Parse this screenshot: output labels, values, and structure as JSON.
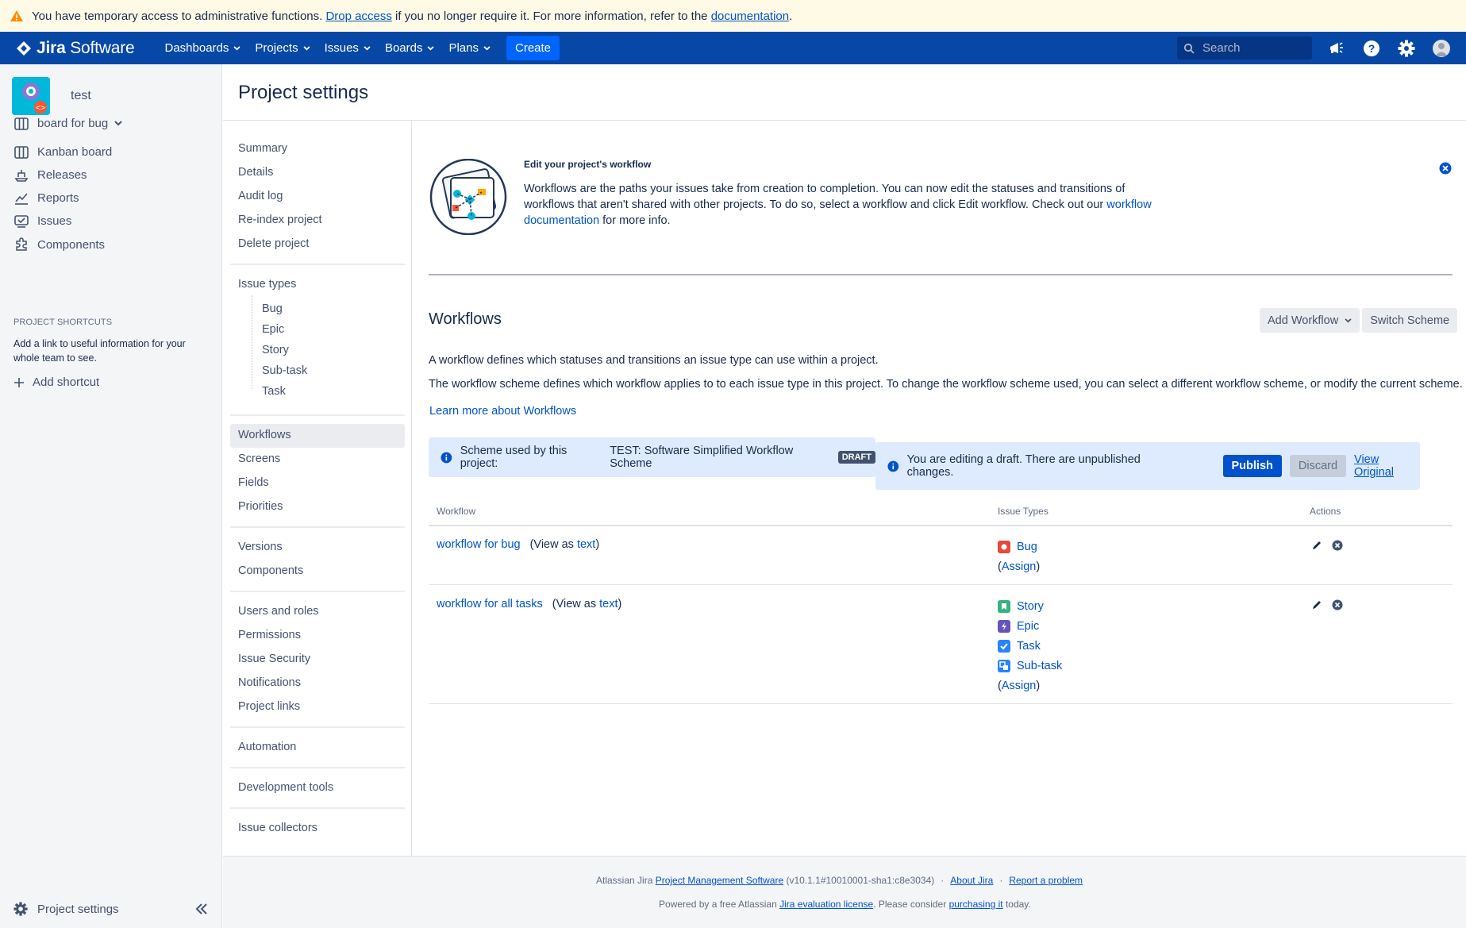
{
  "warning": {
    "text_before": "You have temporary access to administrative functions. ",
    "drop_link": "Drop access",
    "text_middle": " if you no longer require it. For more information, refer to the ",
    "doc_link": "documentation",
    "text_after": "."
  },
  "topnav": {
    "logo_bold": "Jira",
    "logo_rest": "Software",
    "items": [
      "Dashboards",
      "Projects",
      "Issues",
      "Boards",
      "Plans"
    ],
    "create": "Create",
    "search_placeholder": "Search"
  },
  "sidebar": {
    "project_name": "test",
    "board": "board for bug",
    "items": [
      "Kanban board",
      "Releases",
      "Reports",
      "Issues",
      "Components"
    ],
    "shortcuts_heading": "PROJECT SHORTCUTS",
    "shortcuts_desc": "Add a link to useful information for your whole team to see.",
    "add_shortcut": "Add shortcut",
    "footer": "Project settings"
  },
  "page": {
    "title": "Project settings"
  },
  "settings_nav": {
    "group1": [
      "Summary",
      "Details",
      "Audit log",
      "Re-index project",
      "Delete project"
    ],
    "issue_types": "Issue types",
    "issue_type_children": [
      "Bug",
      "Epic",
      "Story",
      "Sub-task",
      "Task"
    ],
    "group3": [
      "Workflows",
      "Screens",
      "Fields",
      "Priorities"
    ],
    "group4": [
      "Versions",
      "Components"
    ],
    "group5": [
      "Users and roles",
      "Permissions",
      "Issue Security",
      "Notifications",
      "Project links"
    ],
    "group6": [
      "Automation"
    ],
    "group7": [
      "Development tools"
    ],
    "group8": [
      "Issue collectors"
    ]
  },
  "info": {
    "title": "Edit your project's workflow",
    "text_before": "Workflows are the paths your issues take from creation to completion. You can now edit the statuses and transitions of workflows that aren't shared with other projects. To do so, select a workflow and click Edit workflow. Check out our ",
    "link": "workflow documentation",
    "text_after": " for more info."
  },
  "workflows": {
    "title": "Workflows",
    "add_workflow": "Add Workflow",
    "switch_scheme": "Switch Scheme",
    "desc1": "A workflow defines which statuses and transitions an issue type can use within a project.",
    "desc2": "The workflow scheme defines which workflow applies to to each issue type in this project. To change the workflow scheme used, you can select a different workflow scheme, or modify the current scheme.",
    "learn_more": "Learn more about Workflows",
    "scheme_label": "Scheme used by this project:",
    "scheme_name": "TEST: Software Simplified Workflow Scheme",
    "draft_lozenge": "DRAFT",
    "draft_msg": "You are editing a draft. There are unpublished changes.",
    "publish": "Publish",
    "discard": "Discard",
    "view_original": "View Original"
  },
  "table": {
    "headers": [
      "Workflow",
      "Issue Types",
      "Actions"
    ],
    "view_as": "(View as ",
    "text_link": "text",
    "close_paren": ")",
    "assign_open": "(",
    "assign": "Assign",
    "assign_close": ")",
    "rows": [
      {
        "name": "workflow for bug",
        "types": [
          "Bug"
        ]
      },
      {
        "name": "workflow for all tasks",
        "types": [
          "Story",
          "Epic",
          "Task",
          "Sub-task"
        ]
      }
    ],
    "type_colors": {
      "Bug": "#e5493a",
      "Story": "#36b37e",
      "Epic": "#6554c0",
      "Task": "#2684ff",
      "Sub-task": "#2684ff"
    }
  },
  "footer": {
    "l1_prefix": "Atlassian Jira ",
    "l1_link": "Project Management Software",
    "l1_version": " (v10.1.1#10010001-sha1:c8e3034)",
    "about": "About Jira",
    "report": "Report a problem",
    "l2_prefix": "Powered by a free Atlassian ",
    "l2_link": "Jira evaluation license",
    "l2_mid": ". Please consider ",
    "l2_link2": "purchasing it",
    "l2_suffix": " today."
  },
  "colors": {
    "nav_bg": "#0747a6",
    "primary": "#0052cc",
    "warning_bg": "#fffae6",
    "info_bg": "#deebff"
  }
}
